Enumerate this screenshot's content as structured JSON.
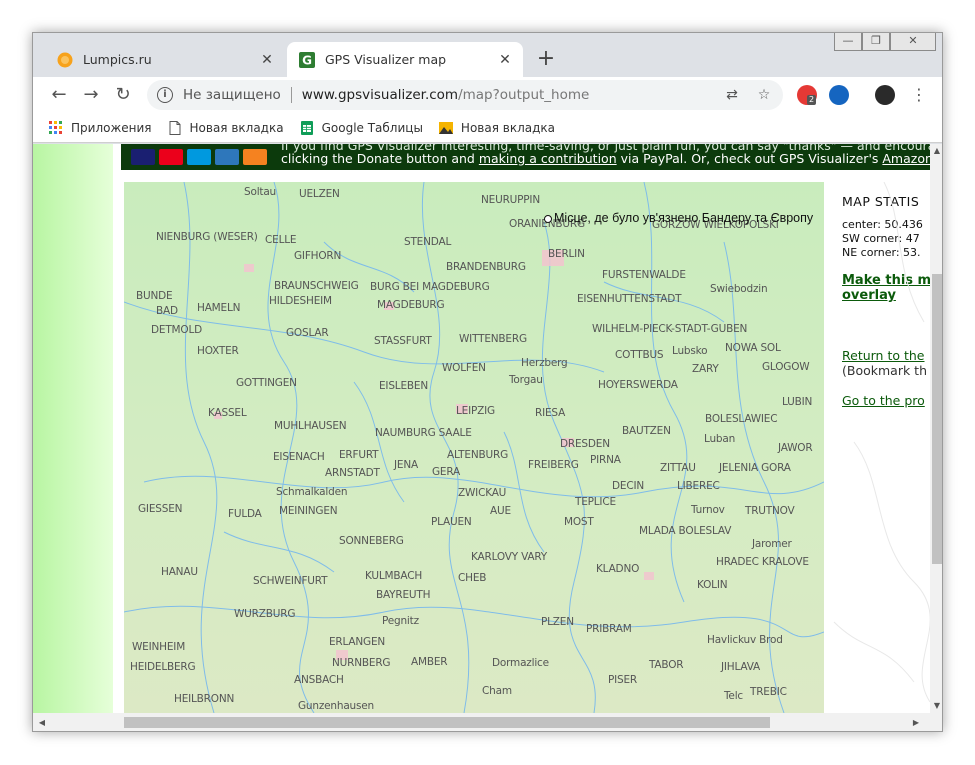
{
  "tabs": [
    {
      "title": "Lumpics.ru",
      "favicon": "orange-circle-icon",
      "active": false
    },
    {
      "title": "GPS Visualizer map",
      "favicon": "gpsvisualizer-g-icon",
      "active": true
    }
  ],
  "toolbar": {
    "security_text": "Не защищено",
    "url_host": "www.gpsvisualizer.com",
    "url_path": "/map?output_home",
    "extension_badge": "2"
  },
  "bookmarks": [
    {
      "label": "Приложения",
      "icon": "apps-grid-icon"
    },
    {
      "label": "Новая вкладка",
      "icon": "page-icon"
    },
    {
      "label": "Google Таблицы",
      "icon": "sheets-icon"
    },
    {
      "label": "Новая вкладка",
      "icon": "image-icon"
    }
  ],
  "donate": {
    "line1": "If you find GPS Visualizer interesting, time-saving, or just plain fun, you can say \"thanks\" — and encourage furt",
    "line2_prefix": "clicking the Donate button and ",
    "line2_link1": "making a contribution",
    "line2_mid": " via PayPal. Or, check out GPS Visualizer's ",
    "line2_link2": "Amazon.com wi"
  },
  "marker": {
    "label": "Місце, де було ув'язнено Бандеру та Європу"
  },
  "map_cities": [
    [
      "Soltau",
      120,
      4
    ],
    [
      "UELZEN",
      175,
      6
    ],
    [
      "NEURUPPIN",
      357,
      12
    ],
    [
      "ORANIENBURG",
      385,
      36
    ],
    [
      "GORZOW WIELKOPOLSKI",
      528,
      37
    ],
    [
      "NIENBURG (WESER)",
      32,
      49
    ],
    [
      "CELLE",
      141,
      52
    ],
    [
      "STENDAL",
      280,
      54
    ],
    [
      "BERLIN",
      424,
      66
    ],
    [
      "GIFHORN",
      170,
      68
    ],
    [
      "BRANDENBURG",
      322,
      79
    ],
    [
      "FURSTENWALDE",
      478,
      87
    ],
    [
      "BRAUNSCHWEIG",
      150,
      98
    ],
    [
      "BURG BEI MAGDEBURG",
      246,
      99
    ],
    [
      "Swiebodzin",
      586,
      101
    ],
    [
      "BUNDE",
      12,
      108
    ],
    [
      "HILDESHEIM",
      145,
      113
    ],
    [
      "EISENHUTTENSTADT",
      453,
      111
    ],
    [
      "BAD",
      32,
      123
    ],
    [
      "HAMELN",
      73,
      120
    ],
    [
      "MAGDEBURG",
      253,
      117
    ],
    [
      "DETMOLD",
      27,
      142
    ],
    [
      "GOSLAR",
      162,
      145
    ],
    [
      "WILHELM-PIECK-STADT-GUBEN",
      468,
      141
    ],
    [
      "STASSFURT",
      250,
      153
    ],
    [
      "WITTENBERG",
      335,
      151
    ],
    [
      "HOXTER",
      73,
      163
    ],
    [
      "Lubsko",
      548,
      163
    ],
    [
      "NOWA SOL",
      601,
      160
    ],
    [
      "COTTBUS",
      491,
      167
    ],
    [
      "Herzberg",
      397,
      175
    ],
    [
      "WOLFEN",
      318,
      180
    ],
    [
      "GLOGOW",
      638,
      179
    ],
    [
      "ZARY",
      568,
      181
    ],
    [
      "Torgau",
      385,
      192
    ],
    [
      "GOTTINGEN",
      112,
      195
    ],
    [
      "EISLEBEN",
      255,
      198
    ],
    [
      "HOYERSWERDA",
      474,
      197
    ],
    [
      "LUBIN",
      658,
      214
    ],
    [
      "KASSEL",
      84,
      225
    ],
    [
      "LEIPZIG",
      332,
      223
    ],
    [
      "RIESA",
      411,
      225
    ],
    [
      "BOLESLAWIEC",
      581,
      231
    ],
    [
      "MUHLHAUSEN",
      150,
      238
    ],
    [
      "NAUMBURG SAALE",
      251,
      245
    ],
    [
      "BAUTZEN",
      498,
      243
    ],
    [
      "Luban",
      580,
      251
    ],
    [
      "DRESDEN",
      436,
      256
    ],
    [
      "JAWOR",
      654,
      260
    ],
    [
      "EISENACH",
      149,
      269
    ],
    [
      "ERFURT",
      215,
      267
    ],
    [
      "ALTENBURG",
      323,
      267
    ],
    [
      "PIRNA",
      466,
      272
    ],
    [
      "JENA",
      270,
      277
    ],
    [
      "ARNSTADT",
      201,
      285
    ],
    [
      "GERA",
      308,
      284
    ],
    [
      "FREIBERG",
      404,
      277
    ],
    [
      "ZITTAU",
      536,
      280
    ],
    [
      "JELENIA GORA",
      595,
      280
    ],
    [
      "Schmalkalden",
      152,
      304
    ],
    [
      "ZWICKAU",
      334,
      305
    ],
    [
      "DECIN",
      488,
      298
    ],
    [
      "LIBEREC",
      553,
      298
    ],
    [
      "TEPLICE",
      451,
      314
    ],
    [
      "GIESSEN",
      14,
      321
    ],
    [
      "FULDA",
      104,
      326
    ],
    [
      "MEININGEN",
      155,
      323
    ],
    [
      "AUE",
      366,
      323
    ],
    [
      "Turnov",
      567,
      322
    ],
    [
      "TRUTNOV",
      621,
      323
    ],
    [
      "PLAUEN",
      307,
      334
    ],
    [
      "MOST",
      440,
      334
    ],
    [
      "MLADA BOLESLAV",
      515,
      343
    ],
    [
      "SONNEBERG",
      215,
      353
    ],
    [
      "Jaromer",
      628,
      356
    ],
    [
      "KARLOVY VARY",
      347,
      369
    ],
    [
      "HRADEC KRALOVE",
      592,
      374
    ],
    [
      "HANAU",
      37,
      384
    ],
    [
      "KLADNO",
      472,
      381
    ],
    [
      "KULMBACH",
      241,
      388
    ],
    [
      "CHEB",
      334,
      390
    ],
    [
      "SCHWEINFURT",
      129,
      393
    ],
    [
      "KOLIN",
      573,
      397
    ],
    [
      "BAYREUTH",
      252,
      407
    ],
    [
      "WURZBURG",
      110,
      426
    ],
    [
      "Pegnitz",
      258,
      433
    ],
    [
      "PLZEN",
      417,
      434
    ],
    [
      "PRIBRAM",
      462,
      441
    ],
    [
      "ERLANGEN",
      205,
      454
    ],
    [
      "Havlickuv Brod",
      583,
      452
    ],
    [
      "WEINHEIM",
      8,
      459
    ],
    [
      "NURNBERG",
      208,
      475
    ],
    [
      "AMBER",
      287,
      474
    ],
    [
      "Dormazlice",
      368,
      475
    ],
    [
      "TABOR",
      525,
      477
    ],
    [
      "JIHLAVA",
      597,
      479
    ],
    [
      "HEIDELBERG",
      6,
      479
    ],
    [
      "ANSBACH",
      170,
      492
    ],
    [
      "PISER",
      484,
      492
    ],
    [
      "Cham",
      358,
      503
    ],
    [
      "TREBIC",
      626,
      504
    ],
    [
      "HEILBRONN",
      50,
      511
    ],
    [
      "Telc",
      600,
      508
    ],
    [
      "Gunzenhausen",
      174,
      518
    ]
  ],
  "sidebar": {
    "stats_title": "MAP STATIS",
    "center": "center: 50.436",
    "sw_corner": "SW corner: 47",
    "ne_corner": "NE corner: 53.",
    "make_line1": "Make this m",
    "make_line2": "overlay",
    "return_link": "Return to the",
    "bookmark_text": "(Bookmark th",
    "goto_link": "Go to the pro"
  }
}
